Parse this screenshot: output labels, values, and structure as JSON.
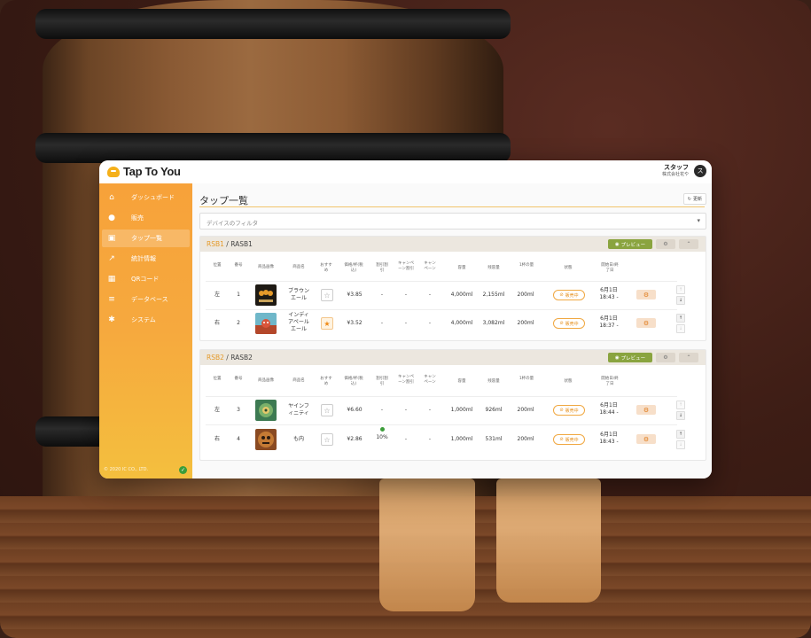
{
  "brand": {
    "name": "Tap To You",
    "accent": "#f5a73a"
  },
  "user": {
    "name": "スタッフ",
    "company": "株式会社花や",
    "avatar_initial": "ス"
  },
  "sidebar": {
    "items": [
      {
        "label": "ダッシュボード",
        "icon": "home-icon"
      },
      {
        "label": "販売",
        "icon": "sales-icon"
      },
      {
        "label": "タップ一覧",
        "icon": "tap-icon",
        "active": true
      },
      {
        "label": "統計情報",
        "icon": "chart-icon"
      },
      {
        "label": "QRコード",
        "icon": "qr-icon"
      },
      {
        "label": "データベース",
        "icon": "database-icon"
      },
      {
        "label": "システム",
        "icon": "system-icon"
      }
    ],
    "copyright": "© 2020 IC CO., LTD."
  },
  "main": {
    "title": "タップ一覧",
    "refresh_label": "更新",
    "filter_placeholder": "デバイスのフィルタ",
    "preview_label": "プレビュー",
    "columns": [
      "位置",
      "番号",
      "商品画像",
      "商品名",
      "おすすめ",
      "価格/杯(税込)",
      "割引割引",
      "キャンペーン割引",
      "キャンペーン",
      "容量",
      "残容量",
      "1杯の量",
      "状態",
      "開始日/終了日"
    ],
    "sections": [
      {
        "primary": "RSB1",
        "secondary": "RASB1",
        "rows": [
          {
            "pos": "左",
            "num": "1",
            "name": "ブラウンエール",
            "fav": false,
            "price": "¥3.85",
            "discount": "-",
            "campaign_disc": "-",
            "campaign": "-",
            "capacity": "4,000ml",
            "remaining": "2,155ml",
            "per_cup": "200ml",
            "status": "販売中",
            "date": "6月1日",
            "time": "18:43 -"
          },
          {
            "pos": "右",
            "num": "2",
            "name": "インディアペールエール",
            "fav": true,
            "price": "¥3.52",
            "discount": "-",
            "campaign_disc": "-",
            "campaign": "-",
            "capacity": "4,000ml",
            "remaining": "3,082ml",
            "per_cup": "200ml",
            "status": "販売中",
            "date": "6月1日",
            "time": "18:37 -"
          }
        ]
      },
      {
        "primary": "RSB2",
        "secondary": "RASB2",
        "rows": [
          {
            "pos": "左",
            "num": "3",
            "name": "ヤインフィニティ",
            "fav": false,
            "price": "¥6.60",
            "discount": "-",
            "campaign_disc": "-",
            "campaign": "-",
            "capacity": "1,000ml",
            "remaining": "926ml",
            "per_cup": "200ml",
            "status": "販売中",
            "date": "6月1日",
            "time": "18:44 -"
          },
          {
            "pos": "右",
            "num": "4",
            "name": "も内",
            "fav": false,
            "price": "¥2.86",
            "discount": "10%",
            "campaign_disc": "-",
            "campaign": "-",
            "capacity": "1,000ml",
            "remaining": "531ml",
            "per_cup": "200ml",
            "status": "販売中",
            "date": "6月1日",
            "time": "18:43 -"
          }
        ]
      }
    ]
  }
}
